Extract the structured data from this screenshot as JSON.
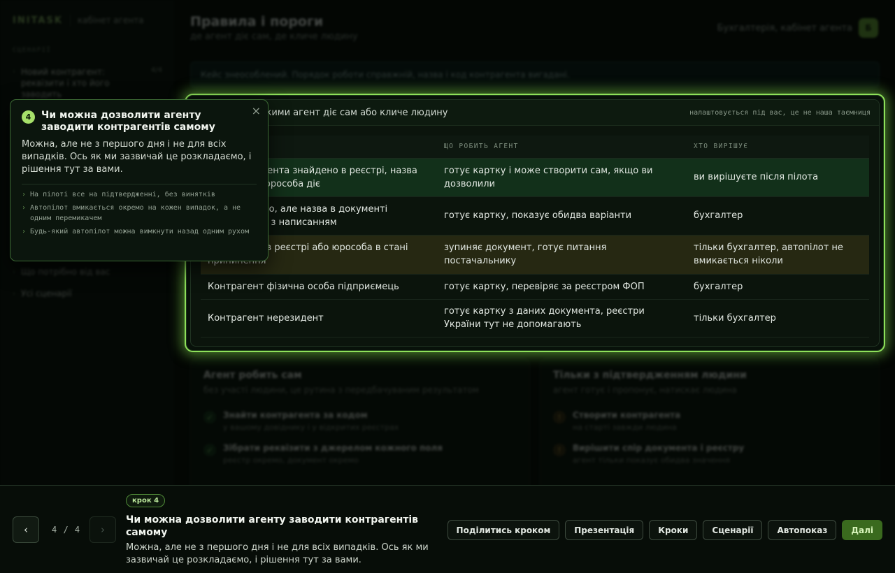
{
  "app": {
    "brand": "INITASK",
    "brand_sub": "кабінет агента",
    "header_title": "Правила і пороги",
    "header_sub": "де агент діє сам, де кличе людину",
    "account": "Бухгалтерія, кабінет агента",
    "avatar": "Б",
    "notice": "Кейс знеособлений. Порядок роботи справжній, назва і код контрагента вигадані."
  },
  "sidebar": {
    "heading": "СЦЕНАРІЇ",
    "items": [
      {
        "label": "Новий контрагент: реквізити і хто його заводить",
        "count": "4/4"
      },
      {
        "label": "Що потрібно від вас"
      },
      {
        "label": "Усі сценарії"
      }
    ]
  },
  "panel": {
    "title": "Правила, за якими агент діє сам або кличе людину",
    "note": "налаштовується під вас, це не наша таємниця",
    "columns": [
      "СИТУАЦІЯ",
      "ЩО РОБИТЬ АГЕНТ",
      "ХТО ВИРІШУЄ"
    ],
    "rows": [
      {
        "situation": "Код контрагента знайдено в реєстрі, назва збігається, юрособа діє",
        "agent": "готує картку і може створити сам, якщо ви дозволили",
        "decides": "ви вирішуєте після пілота"
      },
      {
        "situation": "Код знайдено, але назва в документі розходиться з написанням",
        "agent": "готує картку, показує обидва варіанти",
        "decides": "бухгалтер"
      },
      {
        "situation": "Коду немає в реєстрі або юрособа в стані припинення",
        "agent": "зупиняє документ, готує питання постачальнику",
        "decides": "тільки бухгалтер, автопілот не вмикається ніколи"
      },
      {
        "situation": "Контрагент фізична особа підприємець",
        "agent": "готує картку, перевіряє за реєстром ФОП",
        "decides": "бухгалтер"
      },
      {
        "situation": "Контрагент нерезидент",
        "agent": "готує картку з даних документа, реєстри України тут не допомагають",
        "decides": "тільки бухгалтер"
      }
    ]
  },
  "cards": {
    "left": {
      "title": "Агент робить сам",
      "sub": "без участі людини, це рутина з передбачуваним результатом",
      "items": [
        {
          "title": "Знайти контрагента за кодом",
          "sub": "у вашому довіднику і у відкритих реєстрах"
        },
        {
          "title": "Зібрати реквізити з джерелом кожного поля",
          "sub": "реєстр окремо, документ окремо"
        }
      ]
    },
    "right": {
      "title": "Тільки з підтвердженням людини",
      "sub": "агент готує і пропонує, натискає людина",
      "items": [
        {
          "title": "Створити контрагента",
          "sub": "на старті завжди людина"
        },
        {
          "title": "Вирішити спір документа і реєстру",
          "sub": "агент тільки показує обидва значення"
        }
      ]
    }
  },
  "popover": {
    "step": "4",
    "title": "Чи можна дозволити агенту заводити контрагентів самому",
    "body": "Можна, але не з першого дня і не для всіх випадків. Ось як ми зазвичай це розкладаємо, і рішення тут за вами.",
    "close": "×",
    "bullets": [
      "На пілоті все на підтвердженні, без винятків",
      "Автопілот вмикається окремо на кожен випадок, а не одним перемикачем",
      "Будь-який автопілот можна вимкнути назад одним рухом"
    ]
  },
  "bottom": {
    "prev": "‹",
    "next": "›",
    "pager": "4 / 4",
    "chip": "крок 4",
    "title": "Чи можна дозволити агенту заводити контрагентів самому",
    "sub": "Можна, але не з першого дня і не для всіх випадків. Ось як ми зазвичай це розкладаємо, і рішення тут за вами.",
    "actions": [
      "Поділитись кроком",
      "Презентація",
      "Кроки",
      "Сценарії",
      "Автопоказ"
    ],
    "primary": "Далі"
  },
  "icons": {
    "check": "check-icon",
    "warning": "warning-icon",
    "chevron": "chevron-right-icon",
    "close": "close-icon"
  },
  "colors": {
    "accent": "#8ee05a",
    "row_green": "#12301a",
    "row_amber": "#262812",
    "primary_button": "#3a6a1e"
  }
}
